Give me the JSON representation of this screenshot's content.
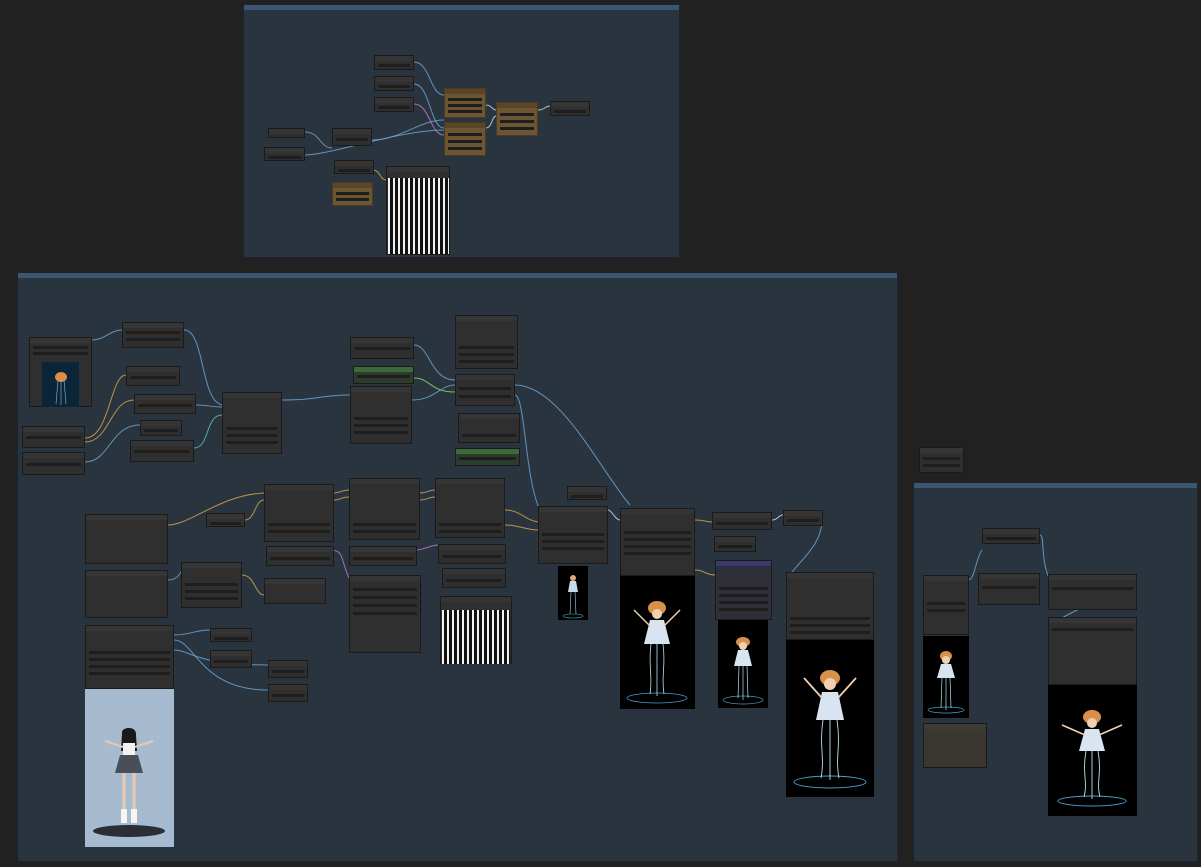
{
  "app": {
    "canvas_background": "#212121",
    "group_color": "#29343f",
    "group_bar_color": "#3c5670"
  },
  "groups": [
    {
      "title": "",
      "color": "#29343f"
    },
    {
      "title": "",
      "color": "#29343f"
    },
    {
      "title": "",
      "color": "#29343f"
    }
  ],
  "colors": {
    "node": "#2f2f2f",
    "node_brown": "#6b5532",
    "node_green": "#3c6a3c",
    "node_purple": "#3d3a6a",
    "edge_blue": "#6aa6d6",
    "edge_orange": "#d6a24a",
    "edge_pink": "#c07ad6",
    "edge_green": "#8ad66a",
    "edge_teal": "#5ac0b8",
    "edge_white": "#cfd8e0"
  },
  "icons": [
    "collapse-dot-icon",
    "link-dot-icon"
  ]
}
